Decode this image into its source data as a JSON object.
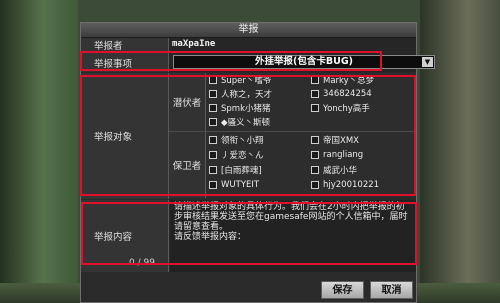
{
  "dialog": {
    "title": "举报"
  },
  "fields": {
    "reporter": {
      "label": "举报者",
      "value": "maXpaIne"
    },
    "category": {
      "label": "举报事项",
      "value": "外挂举报(包含卡BUG)"
    },
    "target": {
      "label": "举报对象"
    },
    "content": {
      "label": "举报内容",
      "counter": "0 / 99"
    }
  },
  "groups": {
    "lurkers": {
      "label": "潜伏者",
      "items": [
        "Super丶嗜爷",
        "Marky丶总梦",
        "人称之，天才",
        "346824254",
        "Spmk小猪猪",
        "Yonchy高手",
        "◆骚义丶斯顿"
      ]
    },
    "defenders": {
      "label": "保卫者",
      "items": [
        "领衔丶小翔",
        "帝国XMX",
        "丿爱恋丶ん",
        "rangliang",
        "[白雨葬魂]",
        "威武小华",
        "WUTYEIT",
        "hjy20010221"
      ]
    },
    "icons": {
      "checkbox": "checkbox-icon",
      "dropdown": "chevron-down-icon"
    }
  },
  "content": {
    "text": "请描述举报对象的具体行为。我们会在2小时内把举报的初步审核结果发送至您在gamesafe网站的个人信箱中，届时请留意查看。\n请反馈举报内容："
  },
  "buttons": {
    "submit": "保存",
    "cancel": "取消"
  },
  "colors": {
    "highlight": "#e0102a",
    "panel": "#2a2a2a",
    "button": "#c8c8c8"
  }
}
